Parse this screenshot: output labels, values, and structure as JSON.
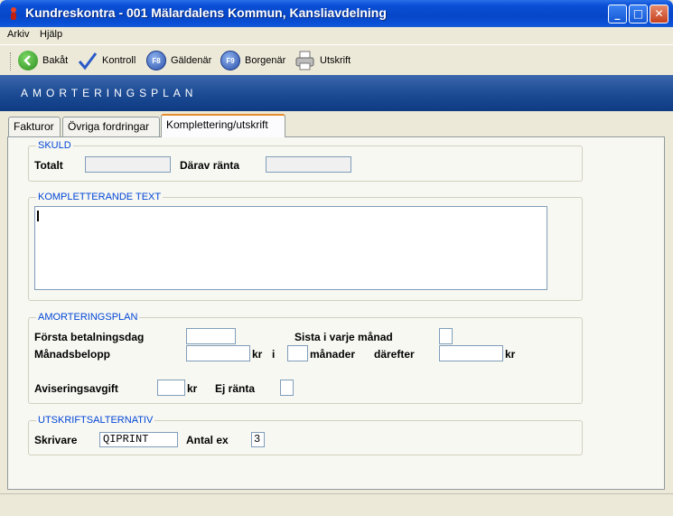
{
  "window": {
    "title": "Kundreskontra  -  001 Mälardalens Kommun, Kansliavdelning"
  },
  "window_controls": {
    "minimize": "_",
    "maximize": "□",
    "close": "✕"
  },
  "menu": [
    {
      "label": "Arkiv"
    },
    {
      "label": "Hjälp"
    }
  ],
  "toolbar": {
    "back": {
      "label": "Bakåt",
      "icon": "back-arrow-icon",
      "color": "#3a9a2a"
    },
    "check": {
      "label": "Kontroll",
      "icon": "checkmark-icon",
      "color": "#2a5ac8"
    },
    "debtor": {
      "label": "Gäldenär",
      "key": "F8"
    },
    "guarantor": {
      "label": "Borgenär",
      "key": "F9"
    },
    "print": {
      "label": "Utskrift",
      "icon": "printer-icon"
    }
  },
  "banner": {
    "title": "AMORTERINGSPLAN"
  },
  "tabs": [
    {
      "label": "Fakturor",
      "active": false
    },
    {
      "label": "Övriga fordringar",
      "active": false
    },
    {
      "label": "Komplettering/utskrift",
      "active": true
    }
  ],
  "skuld": {
    "legend": "SKULD",
    "total_label": "Totalt",
    "total_value": "",
    "interest_label": "Därav ränta",
    "interest_value": ""
  },
  "text_section": {
    "legend": "KOMPLETTERANDE TEXT",
    "value": ""
  },
  "plan": {
    "legend": "AMORTERINGSPLAN",
    "first_day_label": "Första betalningsdag",
    "first_day_value": "",
    "last_each_month_label": "Sista i varje månad",
    "monthly_label": "Månadsbelopp",
    "monthly_value": "",
    "kr_label": "kr",
    "i_label": "i",
    "months_label": "månader",
    "months_value": "",
    "then_label": "därefter",
    "then_value": "",
    "kr2_label": "kr",
    "fee_label": "Aviseringsavgift",
    "fee_value": "",
    "kr3_label": "kr",
    "no_interest_label": "Ej ränta"
  },
  "print": {
    "legend": "UTSKRIFTSALTERNATIV",
    "printer_label": "Skrivare",
    "printer_value": "QIPRINT",
    "copies_label": "Antal ex",
    "copies_value": "3"
  },
  "colors": {
    "accent": "#0046d5",
    "titlebar": "#0a52d9",
    "banner": "#1b4a93",
    "tab_highlight": "#e68b2c"
  }
}
